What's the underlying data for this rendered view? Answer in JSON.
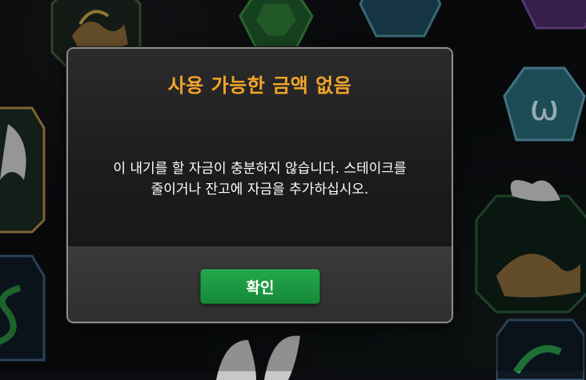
{
  "dialog": {
    "title": "사용 가능한 금액 없음",
    "message_line1": "이 내기를 할 자금이 충분하지 않습니다. 스테이크를",
    "message_line2": "줄이거나 잔고에 자금을 추가하십시오.",
    "confirm_label": "확인"
  },
  "colors": {
    "title": "#f2a42a",
    "confirm_button": "#1c9a42",
    "dialog_border": "#8b8b8b"
  },
  "background_symbols": [
    "winged-sandals-icon",
    "green-gem-icon",
    "blue-gem-icon",
    "purple-gem-icon",
    "wing-icon",
    "serpent-icon"
  ]
}
